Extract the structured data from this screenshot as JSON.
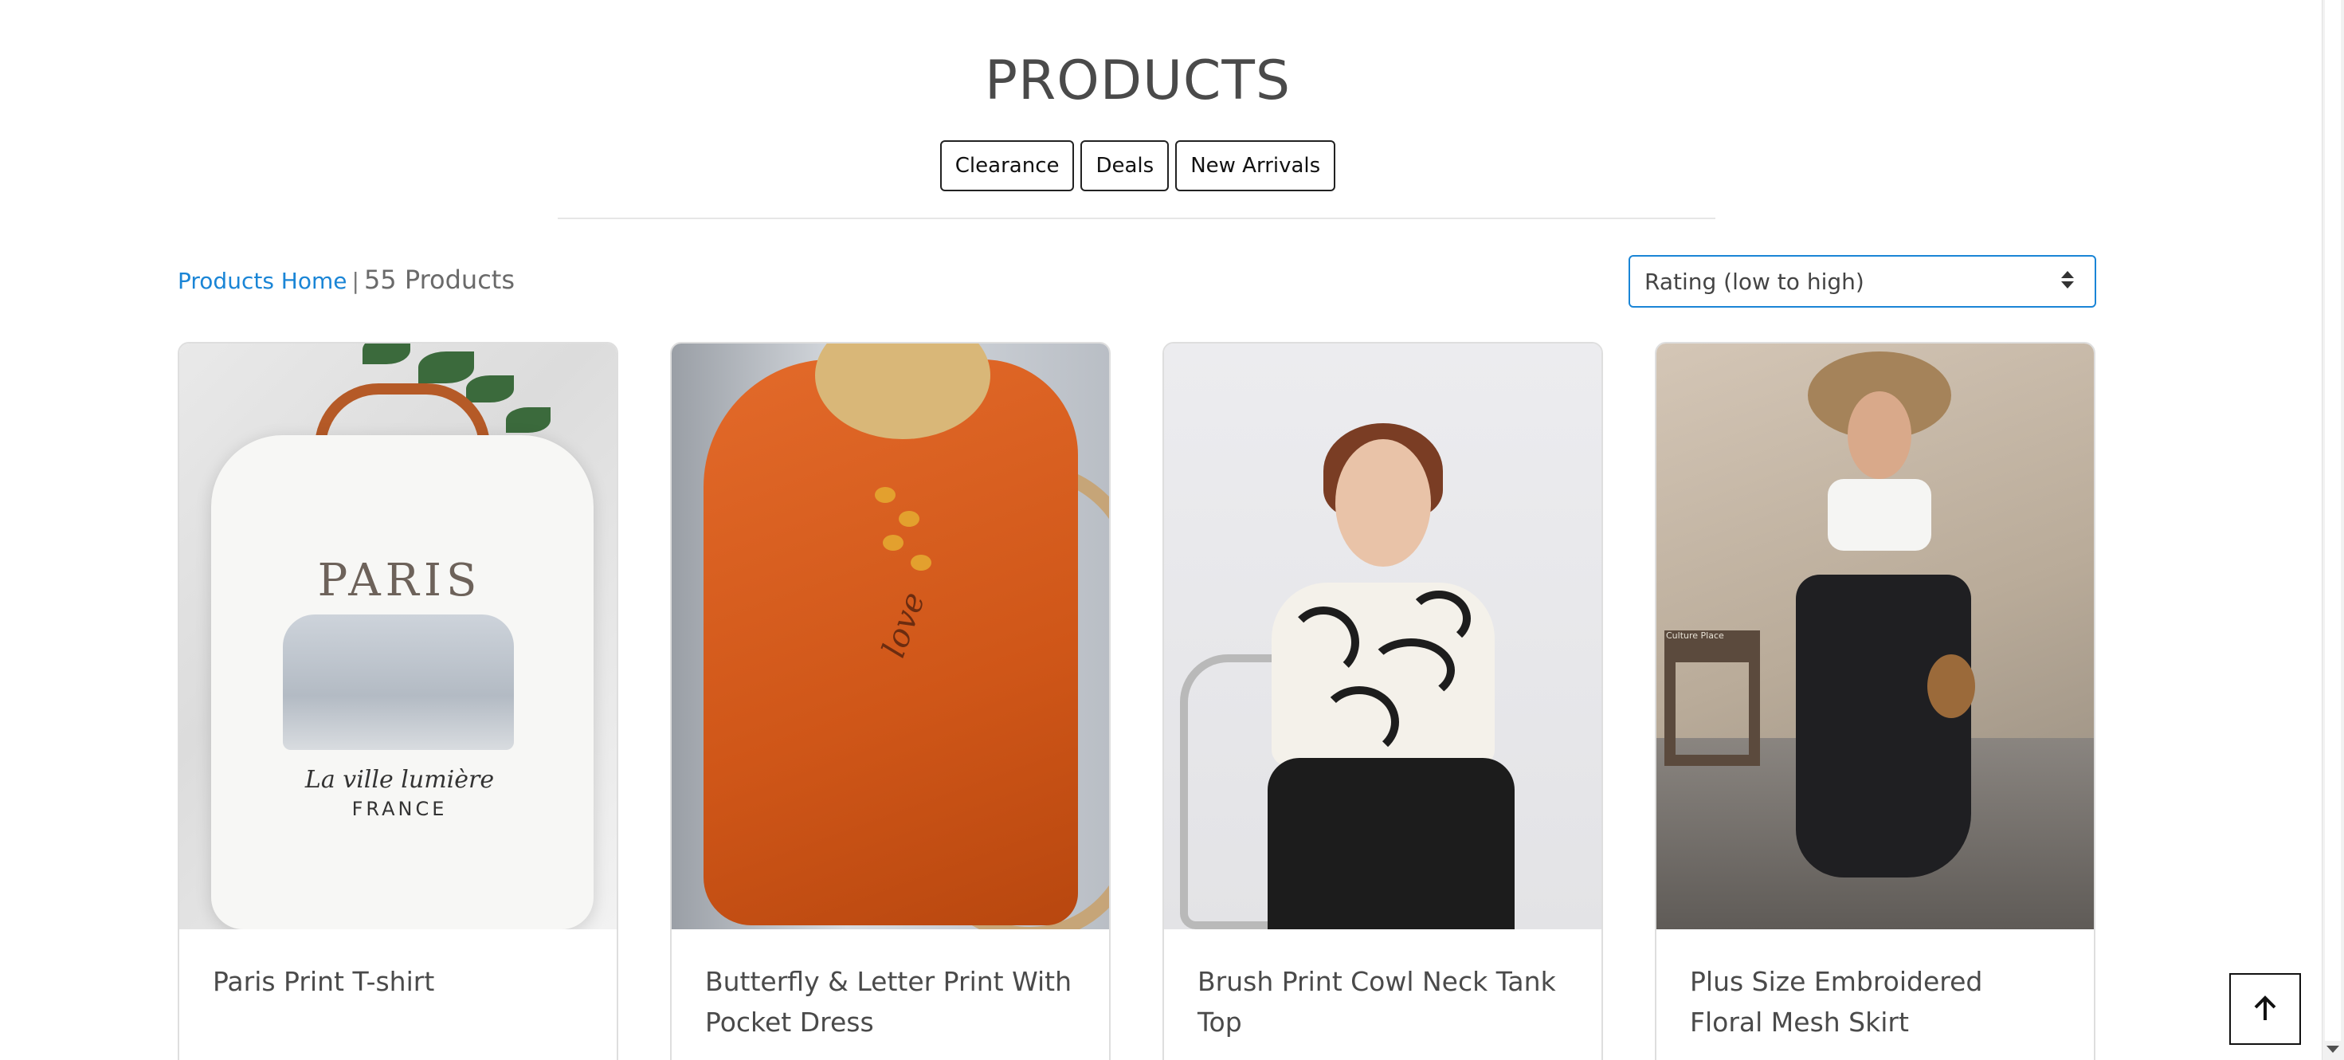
{
  "header": {
    "title": "PRODUCTS",
    "filters": [
      {
        "label": "Clearance"
      },
      {
        "label": "Deals"
      },
      {
        "label": "New Arrivals"
      }
    ]
  },
  "toolbar": {
    "breadcrumb_link": "Products Home",
    "separator": "|",
    "count_label": "55 Products",
    "sort": {
      "selected": "Rating (low to high)"
    }
  },
  "products": [
    {
      "name": "Paris Print T-shirt",
      "image_text": {
        "title": "PARIS",
        "script": "La ville lumière",
        "sub": "FRANCE"
      }
    },
    {
      "name": "Butterfly & Letter Print With Pocket Dress",
      "image_text": {
        "script": "love"
      }
    },
    {
      "name": "Brush Print Cowl Neck Tank Top"
    },
    {
      "name": "Plus Size Embroidered Floral Mesh Skirt",
      "image_text": {
        "sign": "Culture Place"
      }
    }
  ],
  "back_to_top_icon": "arrow-up-icon",
  "colors": {
    "accent": "#1a85d6",
    "text": "#4a4a4a",
    "border": "#dedede"
  }
}
